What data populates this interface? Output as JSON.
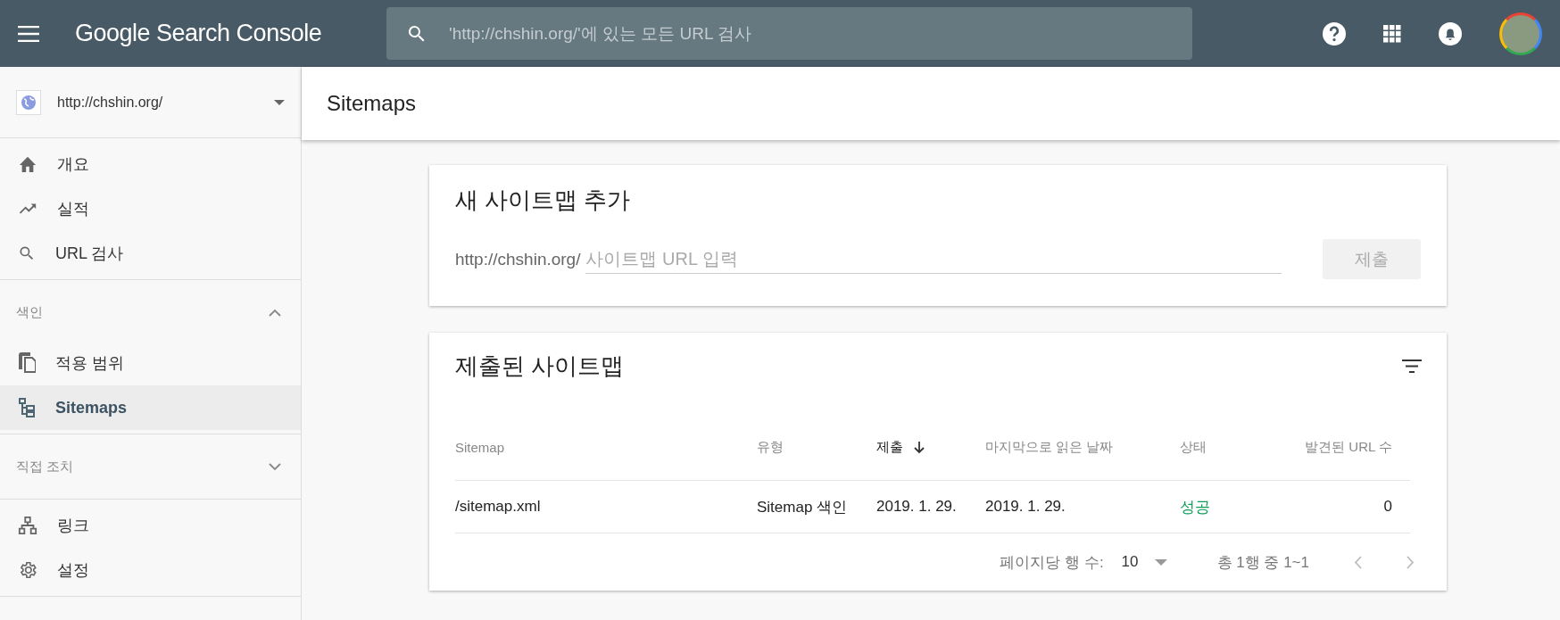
{
  "header": {
    "title": "Google Search Console",
    "search_placeholder": "'http://chshin.org/'에 있는 모든 URL 검사"
  },
  "property": {
    "url": "http://chshin.org/"
  },
  "nav": [
    {
      "items": [
        {
          "label": "개요",
          "selected": false
        },
        {
          "label": "실적",
          "selected": false
        },
        {
          "label": "URL 검사",
          "selected": false
        }
      ]
    },
    {
      "heading": "색인",
      "expanded": true,
      "items": [
        {
          "label": "적용 범위",
          "selected": false
        },
        {
          "label": "Sitemaps",
          "selected": true
        }
      ]
    },
    {
      "heading": "직접 조치",
      "expanded": false
    },
    {
      "items": [
        {
          "label": "링크",
          "selected": false
        },
        {
          "label": "설정",
          "selected": false
        }
      ]
    }
  ],
  "page_title": "Sitemaps",
  "add_card": {
    "title": "새 사이트맵 추가",
    "prefix": "http://chshin.org/",
    "placeholder": "사이트맵 URL 입력",
    "submit": {
      "label": "제출",
      "disabled": true
    }
  },
  "submitted_card": {
    "title": "제출된 사이트맵",
    "columns": [
      {
        "label": "Sitemap",
        "sorted": false
      },
      {
        "label": "유형",
        "sorted": false
      },
      {
        "label": "제출",
        "sorted": true
      },
      {
        "label": "마지막으로 읽은 날짜",
        "sorted": false
      },
      {
        "label": "상태",
        "sorted": false
      },
      {
        "label": "발견된 URL 수",
        "sorted": false
      }
    ],
    "rows": [
      {
        "cells": [
          "/sitemap.xml",
          "Sitemap 색인",
          "2019. 1. 29.",
          "2019. 1. 29.",
          "성공",
          "0"
        ],
        "color": "#0f9d58"
      }
    ],
    "pagination": {
      "rows_per_page_label": "페이지당 행 수:",
      "rows_per_page": "10",
      "range": "총 1행 중 1~1"
    }
  }
}
